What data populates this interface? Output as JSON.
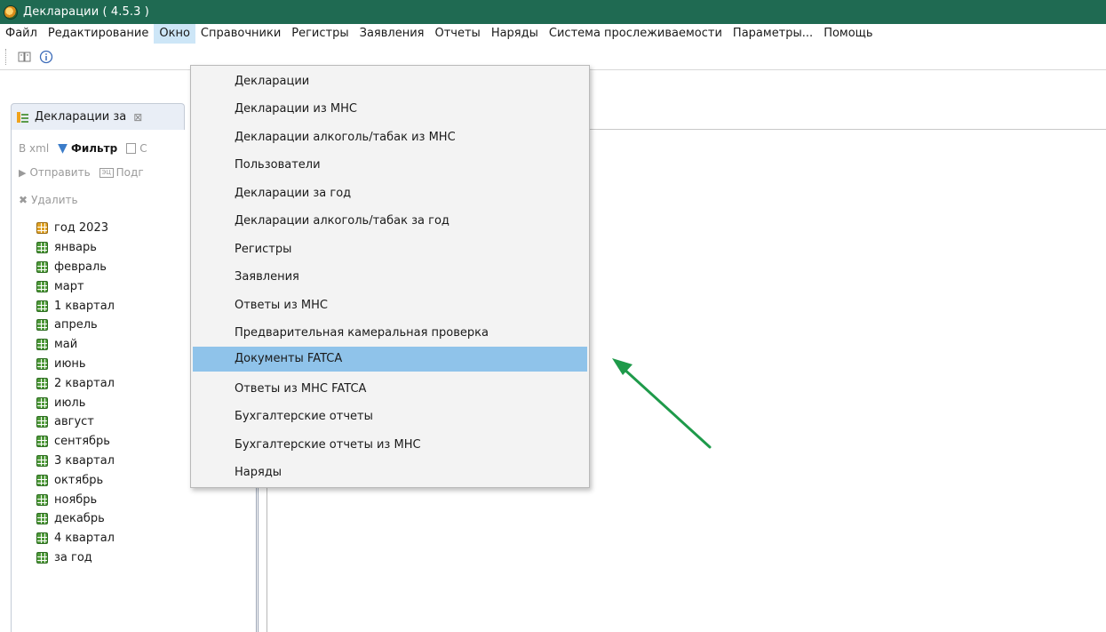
{
  "window": {
    "title": "Декларации ( 4.5.3 )"
  },
  "menubar": {
    "items": [
      "Файл",
      "Редактирование",
      "Окно",
      "Справочники",
      "Регистры",
      "Заявления",
      "Отчеты",
      "Наряды",
      "Система прослеживаемости",
      "Параметры...",
      "Помощь"
    ],
    "active_index": 2
  },
  "toolbar": {
    "icons": [
      "split-view-icon",
      "info-icon"
    ]
  },
  "view_tab": {
    "label": "Декларации за",
    "close_glyph": "⊠"
  },
  "panel_toolbar": {
    "xml_label": "В xml",
    "filter_label": "Фильтр",
    "copy_label": "С",
    "send_label": "Отправить",
    "sign_label": "Подг",
    "sign_icon_text": "ЭЦ",
    "delete_label": "Удалить"
  },
  "tree": {
    "root": "год 2023",
    "items": [
      "январь",
      "февраль",
      "март",
      "1 квартал",
      "апрель",
      "май",
      "июнь",
      "2 квартал",
      "июль",
      "август",
      "сентябрь",
      "3 квартал",
      "октябрь",
      "ноябрь",
      "декабрь",
      "4 квартал",
      "за год"
    ]
  },
  "window_menu": {
    "items": [
      "Декларации",
      "Декларации из МНС",
      "Декларации алкоголь/табак из МНС",
      "Пользователи",
      "Декларации за год",
      "Декларации алкоголь/табак за год",
      "Регистры",
      "Заявления",
      "Ответы из МНС",
      "Предварительная камеральная проверка",
      "Документы FATCA",
      "Ответы из МНС FATCA",
      "Бухгалтерские отчеты",
      "Бухгалтерские отчеты из МНС",
      "Наряды"
    ],
    "selected_index": 10
  },
  "colors": {
    "titlebar": "#1f6a52",
    "menu_active": "#cde6f7",
    "menu_selected": "#8fc3ea",
    "arrow": "#1e9a4a"
  }
}
